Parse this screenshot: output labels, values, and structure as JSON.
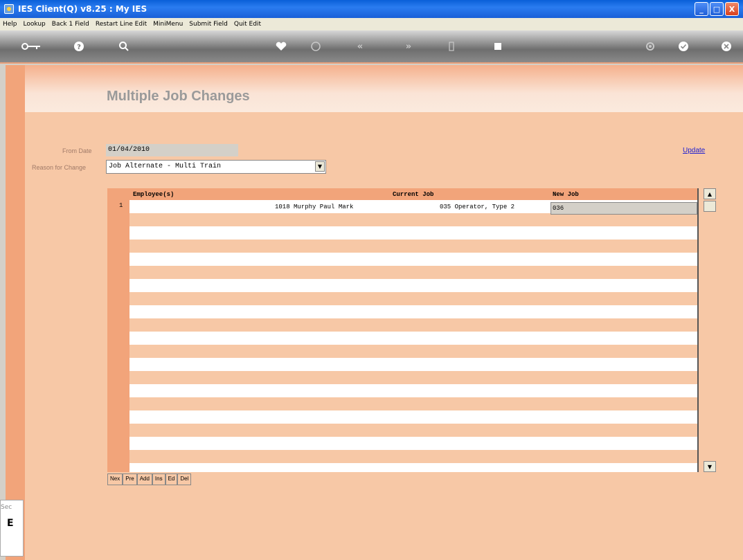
{
  "window": {
    "title": "IES Client(Q) v8.25 : My IES",
    "min": "_",
    "max": "□",
    "close": "X"
  },
  "menu": [
    "Help",
    "Lookup",
    "Back 1 Field",
    "Restart Line Edit",
    "MiniMenu",
    "Submit Field",
    "Quit Edit"
  ],
  "toolbar": {
    "icons": [
      "key-icon",
      "help-icon",
      "search-icon",
      "heart-icon",
      "clock-icon",
      "first-icon",
      "last-icon",
      "marker-icon",
      "stop-icon",
      "settings-icon",
      "check-icon",
      "close-icon"
    ]
  },
  "page": {
    "title": "Multiple Job Changes"
  },
  "form": {
    "from_date_label": "From Date",
    "from_date": "01/04/2010",
    "reason_label": "Reason for Change",
    "reason": "Job Alternate - Multi Train",
    "update": "Update"
  },
  "grid": {
    "columns": [
      "Employee(s)",
      "Current Job",
      "New Job"
    ],
    "rows": [
      {
        "num": "1",
        "employee": "1018 Murphy Paul Mark",
        "current_job": "035 Operator, Type 2",
        "new_job": "036"
      }
    ]
  },
  "nav": [
    "Nex",
    "Pre",
    "Add",
    "Ins",
    "Ed",
    "Del"
  ],
  "stub": {
    "label": "Sec",
    "char": "E"
  }
}
